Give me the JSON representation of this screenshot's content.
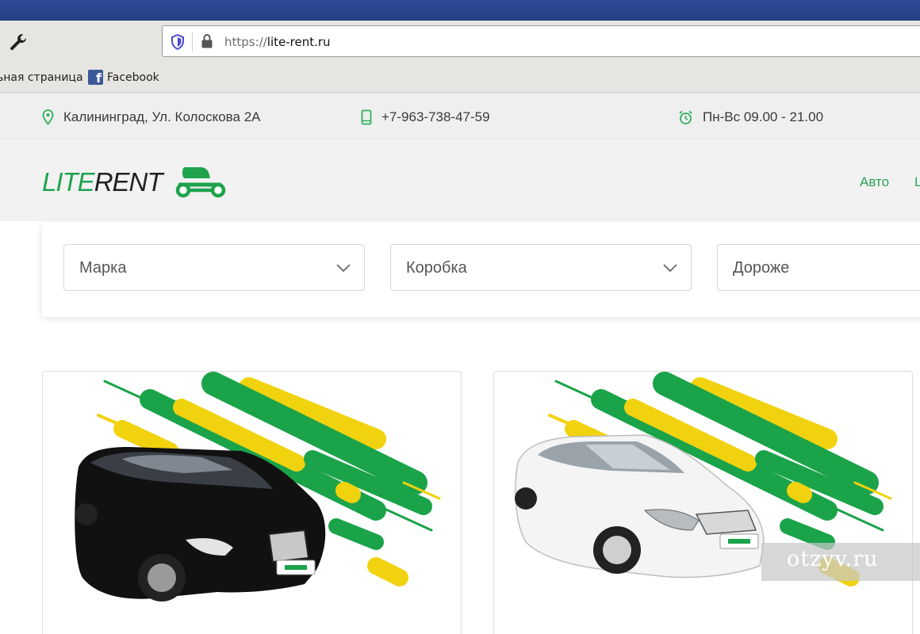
{
  "browser": {
    "url_protocol": "https://",
    "url_host": "lite-rent.ru",
    "bookmarks": [
      {
        "label": "ьная страница"
      },
      {
        "label": "Facebook"
      }
    ]
  },
  "topbar": {
    "address": "Калининград, Ул. Колоскова 2А",
    "phone": "+7-963-738-47-59",
    "hours": "Пн-Вс 09.00 - 21.00"
  },
  "header": {
    "logo_part1": "LITE",
    "logo_part2": "RENT",
    "nav": [
      {
        "label": "Авто"
      },
      {
        "label": "L"
      }
    ]
  },
  "filters": {
    "brand": "Марка",
    "gearbox": "Коробка",
    "sort": "Дороже"
  },
  "watermark": "otzyv.ru",
  "colors": {
    "brand_green": "#1fa34d",
    "accent_yellow": "#f2d410",
    "nav_green": "#29a35a"
  }
}
